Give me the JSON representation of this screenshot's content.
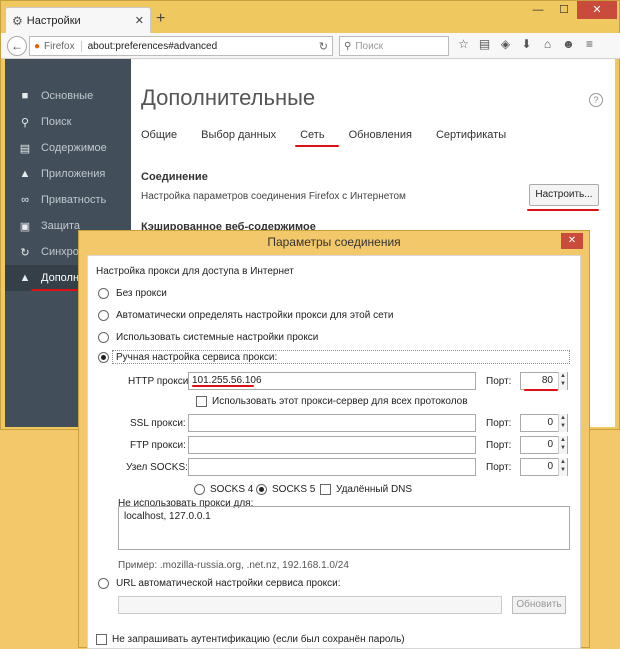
{
  "browser": {
    "tab_title": "Настройки",
    "window_controls": {
      "minimize": "—",
      "maximize": "☐",
      "close": "✕"
    },
    "url_label": "Firefox",
    "url": "about:preferences#advanced",
    "search_placeholder": "Поиск"
  },
  "sidebar": {
    "items": [
      {
        "label": "Основные",
        "icon": "home-icon"
      },
      {
        "label": "Поиск",
        "icon": "search-icon"
      },
      {
        "label": "Содержимое",
        "icon": "document-icon"
      },
      {
        "label": "Приложения",
        "icon": "rocket-icon"
      },
      {
        "label": "Приватность",
        "icon": "mask-icon"
      },
      {
        "label": "Защита",
        "icon": "lock-icon"
      },
      {
        "label": "Синхрон",
        "icon": "sync-icon"
      },
      {
        "label": "Дополни",
        "icon": "hat-icon"
      }
    ],
    "active_index": 7
  },
  "prefs": {
    "title": "Дополнительные",
    "help": "?",
    "tabs": [
      "Общие",
      "Выбор данных",
      "Сеть",
      "Обновления",
      "Сертификаты"
    ],
    "active_tab": 2,
    "connection_heading": "Соединение",
    "connection_desc": "Настройка параметров соединения Firefox с Интернетом",
    "configure_button": "Настроить...",
    "cache_heading": "Кэшированное веб-содержимое"
  },
  "dialog": {
    "title": "Параметры соединения",
    "close": "✕",
    "group_label": "Настройка прокси для доступа в Интернет",
    "options": [
      {
        "label": "Без прокси",
        "selected": false
      },
      {
        "label": "Автоматически определять настройки прокси для этой сети",
        "selected": false
      },
      {
        "label": "Использовать системные настройки прокси",
        "selected": false
      },
      {
        "label": "Ручная настройка сервиса прокси:",
        "selected": true
      }
    ],
    "http": {
      "label": "HTTP прокси:",
      "value": "101.255.56.106",
      "port_label": "Порт:",
      "port": "80"
    },
    "use_for_all": "Использовать этот прокси-сервер для всех протоколов",
    "ssl": {
      "label": "SSL прокси:",
      "value": "",
      "port_label": "Порт:",
      "port": "0"
    },
    "ftp": {
      "label": "FTP прокси:",
      "value": "",
      "port_label": "Порт:",
      "port": "0"
    },
    "socks": {
      "label": "Узел SOCKS:",
      "value": "",
      "port_label": "Порт:",
      "port": "0"
    },
    "socks4": "SOCKS 4",
    "socks5": "SOCKS 5",
    "remote_dns": "Удалённый DNS",
    "no_proxy_label": "Не использовать прокси для:",
    "no_proxy_value": "localhost, 127.0.0.1",
    "example": "Пример: .mozilla-russia.org, .net.nz, 192.168.1.0/24",
    "auto_url_label": "URL автоматической настройки сервиса прокси:",
    "auto_url_value": "",
    "refresh_button": "Обновить",
    "no_auth_prompt": "Не запрашивать аутентификацию (если был сохранён пароль)"
  }
}
